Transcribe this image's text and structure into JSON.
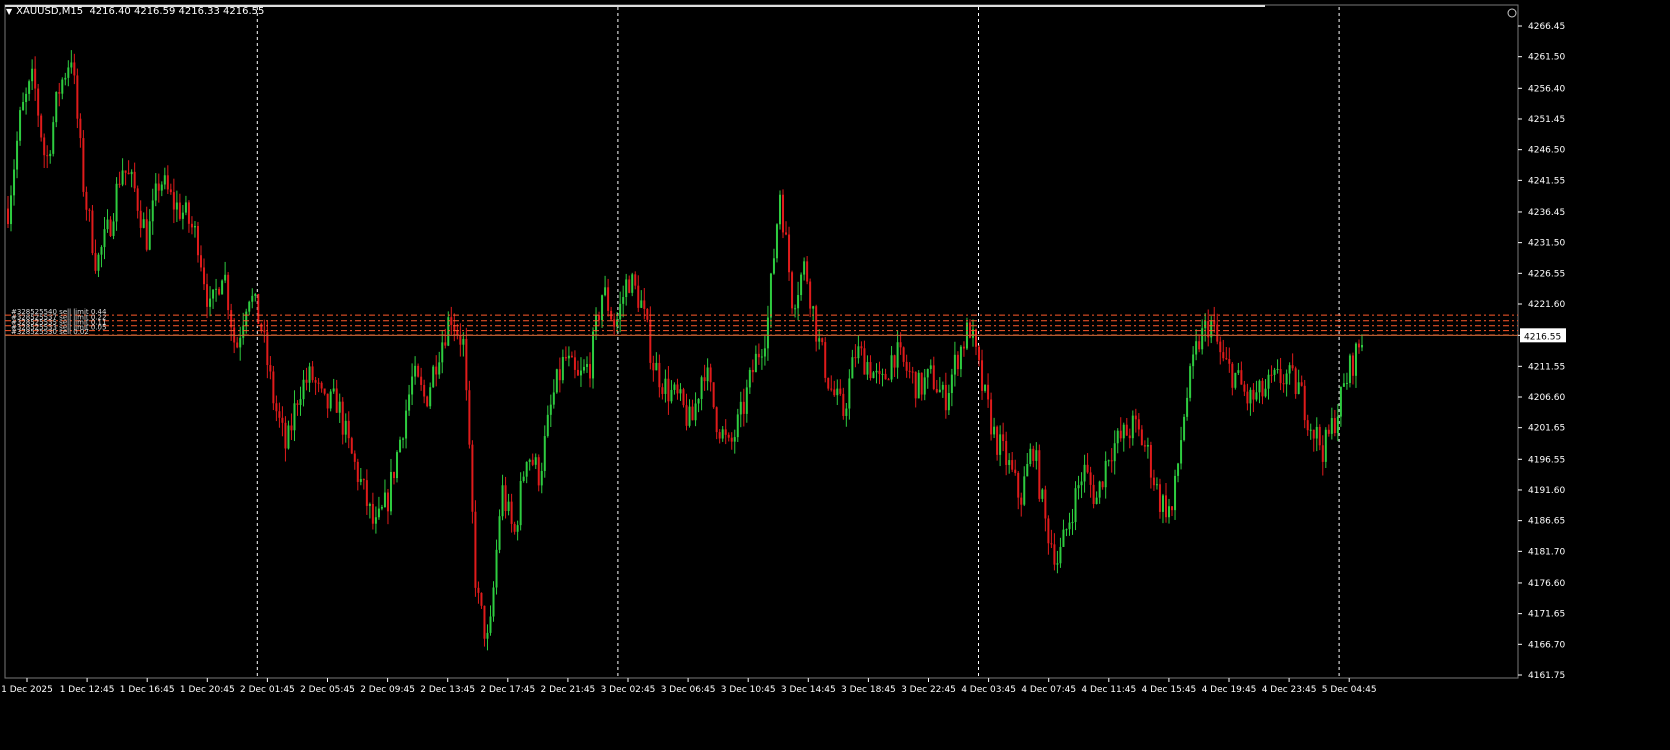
{
  "header": {
    "symbol_timeframe": "XAUUSD,M15",
    "ohlc": "4216.40 4216.59 4216.33 4216.55",
    "collapse_icon": "triangle-down-icon"
  },
  "colors": {
    "background": "#000000",
    "bull": "#2ecc40",
    "bear": "#e01b1b",
    "grid": "#ffffff",
    "axis": "#ffffff",
    "order_line": "#ff5a2a",
    "price_line": "#c86a3a"
  },
  "chart_data": {
    "type": "candlestick",
    "title": "XAUUSD,M15",
    "ylim": [
      4161.7,
      4268.0
    ],
    "y_ticks": [
      "4266.45",
      "4261.50",
      "4256.40",
      "4251.45",
      "4246.50",
      "4241.55",
      "4236.45",
      "4231.50",
      "4226.55",
      "4221.60",
      "4216.55",
      "4211.55",
      "4206.60",
      "4201.65",
      "4196.55",
      "4191.60",
      "4186.65",
      "4181.70",
      "4176.60",
      "4171.65",
      "4166.70",
      "4161.75"
    ],
    "x_ticks": [
      "1 Dec 2025",
      "1 Dec 12:45",
      "1 Dec 16:45",
      "1 Dec 20:45",
      "2 Dec 01:45",
      "2 Dec 05:45",
      "2 Dec 09:45",
      "2 Dec 13:45",
      "2 Dec 17:45",
      "2 Dec 21:45",
      "3 Dec 02:45",
      "3 Dec 06:45",
      "3 Dec 10:45",
      "3 Dec 14:45",
      "3 Dec 18:45",
      "3 Dec 22:45",
      "4 Dec 03:45",
      "4 Dec 07:45",
      "4 Dec 11:45",
      "4 Dec 15:45",
      "4 Dec 19:45",
      "4 Dec 23:45",
      "5 Dec 04:45"
    ],
    "day_separators_after_tick": [
      "1 Dec 20:45",
      "2 Dec 21:45",
      "3 Dec 22:45",
      "4 Dec 23:45"
    ],
    "current_price": "4216.55",
    "orders": [
      {
        "label": "#328525540 sell limit 0.44",
        "price": 4219.8
      },
      {
        "label": "#328525537 sell limit 0.22",
        "price": 4218.9
      },
      {
        "label": "#328525535 sell limit 0.11",
        "price": 4218.1
      },
      {
        "label": "#328525533 sell limit 0.05",
        "price": 4217.3
      },
      {
        "label": "#328525530 sell 0.02",
        "price": 4216.6
      }
    ],
    "path": [
      4237,
      4252,
      4258,
      4244,
      4256,
      4262,
      4240,
      4228,
      4234,
      4244,
      4240,
      4232,
      4242,
      4238,
      4236,
      4232,
      4220,
      4228,
      4214,
      4224,
      4218,
      4206,
      4198,
      4208,
      4210,
      4205,
      4206,
      4198,
      4192,
      4185,
      4190,
      4200,
      4210,
      4206,
      4214,
      4220,
      4215,
      4175,
      4166,
      4192,
      4184,
      4198,
      4194,
      4206,
      4213,
      4209,
      4212,
      4224,
      4218,
      4226,
      4222,
      4212,
      4208,
      4206,
      4202,
      4212,
      4203,
      4198,
      4204,
      4212,
      4218,
      4240,
      4222,
      4228,
      4216,
      4208,
      4204,
      4214,
      4212,
      4208,
      4214,
      4211,
      4208,
      4210,
      4206,
      4213,
      4218,
      4208,
      4200,
      4196,
      4190,
      4199,
      4186,
      4180,
      4188,
      4195,
      4190,
      4198,
      4200,
      4202,
      4198,
      4190,
      4188,
      4205,
      4215,
      4219,
      4212,
      4210,
      4206,
      4207,
      4209,
      4210,
      4208,
      4202,
      4198,
      4204,
      4211,
      4216
    ]
  }
}
